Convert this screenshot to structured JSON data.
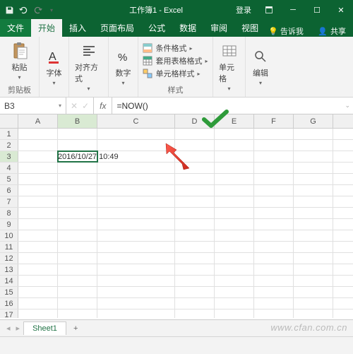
{
  "titlebar": {
    "document_title": "工作簿1 - Excel",
    "login": "登录"
  },
  "tabs": {
    "file": "文件",
    "home": "开始",
    "insert": "插入",
    "page_layout": "页面布局",
    "formulas": "公式",
    "data": "数据",
    "review": "审阅",
    "view": "视图",
    "tell_me": "告诉我",
    "share": "共享"
  },
  "ribbon": {
    "clipboard": {
      "paste": "粘贴",
      "label": "剪贴板"
    },
    "font": {
      "btn": "字体"
    },
    "alignment": {
      "btn": "对齐方式"
    },
    "number": {
      "btn": "数字"
    },
    "styles": {
      "conditional": "条件格式",
      "format_table": "套用表格格式",
      "cell_styles": "单元格样式",
      "label": "样式"
    },
    "cells": {
      "btn": "单元格"
    },
    "editing": {
      "btn": "编辑"
    }
  },
  "namebox": {
    "ref": "B3",
    "fx": "fx",
    "formula": "=NOW()"
  },
  "grid": {
    "columns": [
      "A",
      "B",
      "C",
      "D",
      "E",
      "F",
      "G"
    ],
    "row_count": 17,
    "active_cell": "B3",
    "b3_value": "2016/10/27 10:49"
  },
  "sheets": {
    "sheet1": "Sheet1",
    "add": "+"
  },
  "watermark": "www.cfan.com.cn",
  "chart_data": null
}
